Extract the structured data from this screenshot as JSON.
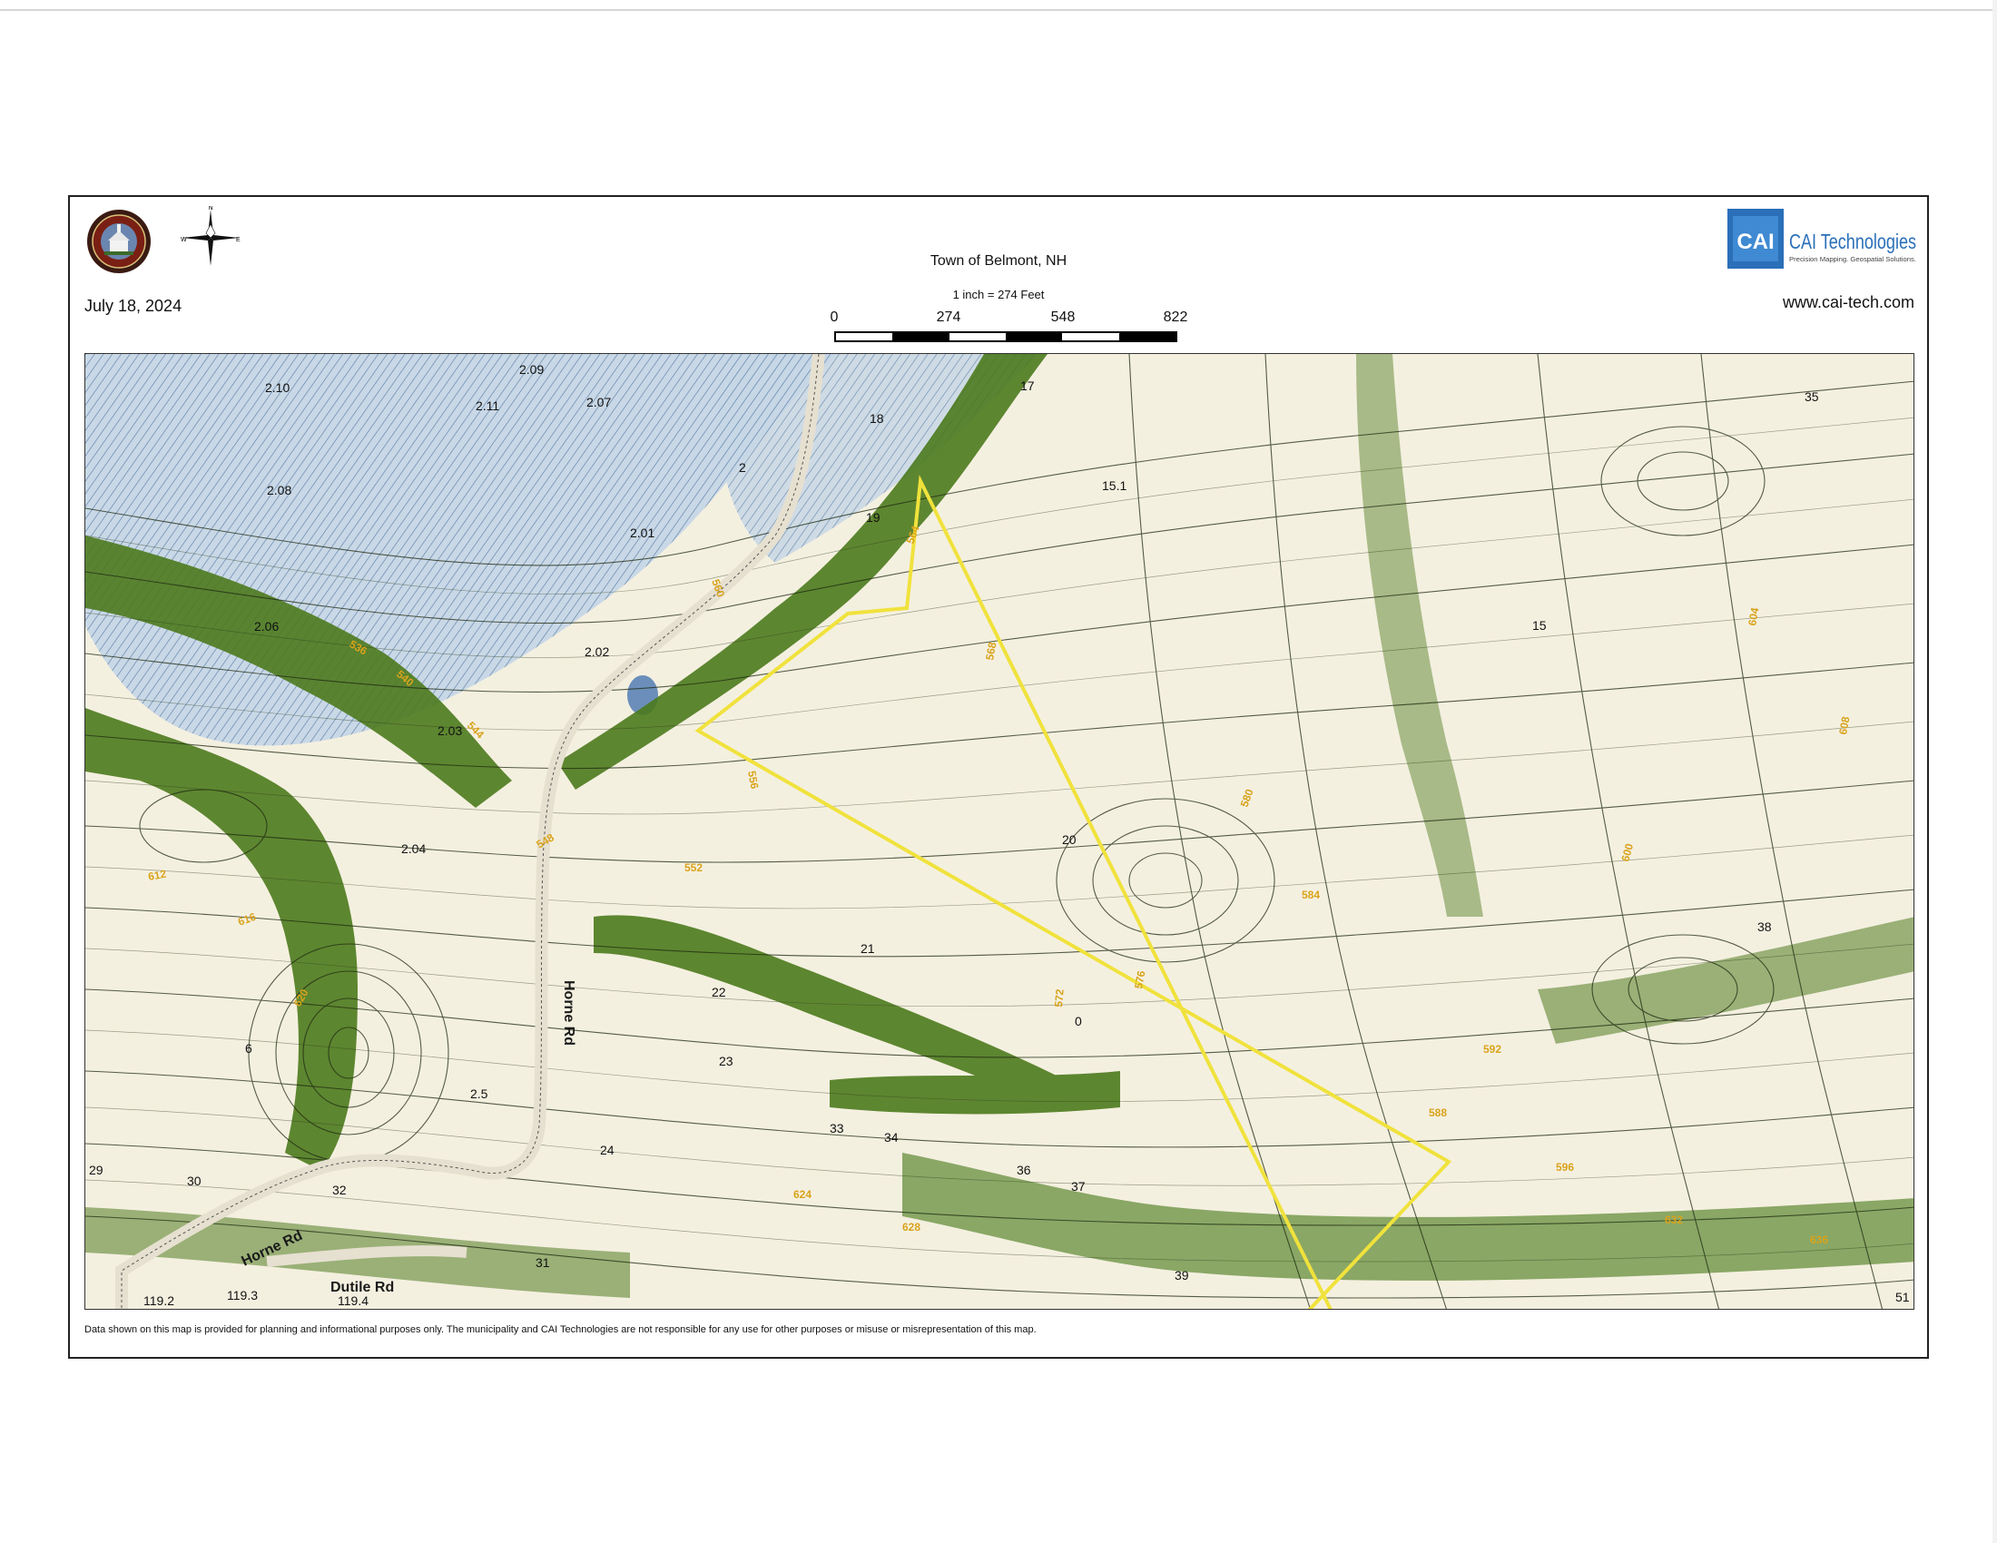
{
  "header": {
    "title": "Town of Belmont, NH",
    "date": "July 18, 2024",
    "scale_text": "1 inch = 274 Feet",
    "scale_labels": [
      "0",
      "274",
      "548",
      "822"
    ],
    "company_name": "CAI Technologies",
    "company_badge": "CAI",
    "company_tagline": "Precision Mapping. Geospatial Solutions.",
    "company_url": "www.cai-tech.com",
    "seal_text": "Town of Belmont New Hampshire"
  },
  "compass": {
    "n": "N",
    "s": "S",
    "e": "E",
    "w": "W"
  },
  "colors": {
    "terrain_dark": "#3f6d1b",
    "terrain_mid": "#6f9a2e",
    "terrain_light": "#a8c070",
    "contour": "#1f2a12",
    "contour_label": "#d9a31c",
    "water_hatch": "#5d7fa8",
    "water_fill": "#c7d7e6",
    "parcel_line": "#f0e23c",
    "road": "#e6e0d0"
  },
  "map": {
    "roads": [
      {
        "id": "horne-rd-north",
        "label": "Horne Rd"
      },
      {
        "id": "horne-rd-south",
        "label": "Horne Rd"
      },
      {
        "id": "dutile-rd",
        "label": "Dutile Rd"
      }
    ],
    "parcel_labels": [
      "2.10",
      "2.09",
      "2.11",
      "2.07",
      "18",
      "2",
      "17",
      "15.1",
      "2.08",
      "2.01",
      "19",
      "2.06",
      "2.02",
      "2.03",
      "2.04",
      "20",
      "21",
      "22",
      "23",
      "6",
      "2.5",
      "24",
      "33",
      "34",
      "36",
      "37",
      "29",
      "30",
      "32",
      "31",
      "35",
      "38",
      "39",
      "119.2",
      "119.3",
      "119.4",
      "51",
      "15",
      "0"
    ],
    "contour_labels": [
      "536",
      "540",
      "544",
      "548",
      "552",
      "556",
      "560",
      "564",
      "568",
      "572",
      "576",
      "580",
      "584",
      "588",
      "592",
      "596",
      "600",
      "604",
      "608",
      "612",
      "616",
      "620",
      "624",
      "628",
      "632",
      "636"
    ]
  },
  "footer": {
    "disclaimer": "Data shown on this map is provided for planning and informational purposes only. The municipality and CAI Technologies are not responsible for any use for other purposes or misuse or misrepresentation of this map."
  }
}
